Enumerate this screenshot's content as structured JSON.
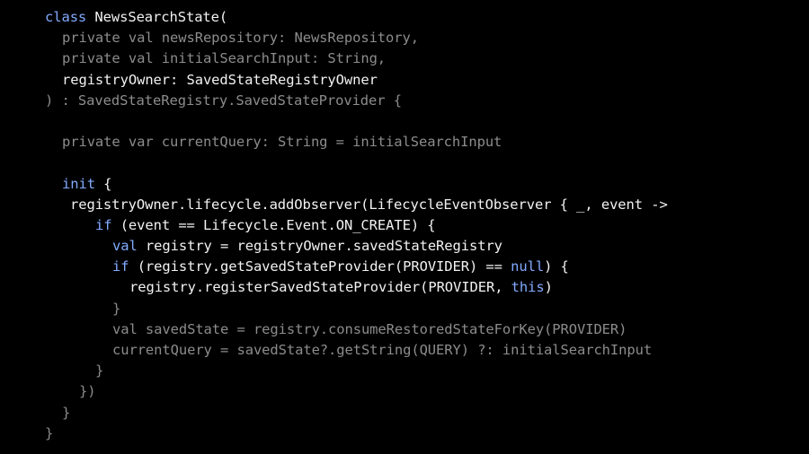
{
  "editor": {
    "colors": {
      "background": "#000000",
      "keyword": "#82aaff",
      "text": "#f2f2f2",
      "dimmed": "#8c8c8c"
    },
    "lines": [
      {
        "indent": 50,
        "tokens": [
          {
            "t": "class ",
            "c": "kw"
          },
          {
            "t": "NewsSearchState(",
            "c": "hi"
          }
        ]
      },
      {
        "indent": 69,
        "tokens": [
          {
            "t": "private val newsRepository: NewsRepository,",
            "c": "dim"
          }
        ]
      },
      {
        "indent": 69,
        "tokens": [
          {
            "t": "private val initialSearchInput: String,",
            "c": "dim"
          }
        ]
      },
      {
        "indent": 69,
        "tokens": [
          {
            "t": "registryOwner: SavedStateRegistryOwner",
            "c": "hi"
          }
        ]
      },
      {
        "indent": 50,
        "tokens": [
          {
            "t": ") : SavedStateRegistry.SavedStateProvider {",
            "c": "dim"
          }
        ]
      },
      {
        "indent": 50,
        "tokens": []
      },
      {
        "indent": 69,
        "tokens": [
          {
            "t": "private var currentQuery: String = initialSearchInput",
            "c": "dim"
          }
        ]
      },
      {
        "indent": 50,
        "tokens": []
      },
      {
        "indent": 69,
        "tokens": [
          {
            "t": "init",
            "c": "kw"
          },
          {
            "t": " {",
            "c": "hi"
          }
        ]
      },
      {
        "indent": 78,
        "tokens": [
          {
            "t": "registryOwner.lifecycle.addObserver(LifecycleEventObserver { _, event ->",
            "c": "hi"
          }
        ]
      },
      {
        "indent": 106,
        "tokens": [
          {
            "t": "if",
            "c": "kw"
          },
          {
            "t": " (event == Lifecycle.Event.ON_CREATE) {",
            "c": "hi"
          }
        ]
      },
      {
        "indent": 125,
        "tokens": [
          {
            "t": "val",
            "c": "kw"
          },
          {
            "t": " registry = registryOwner.savedStateRegistry",
            "c": "hi"
          }
        ]
      },
      {
        "indent": 125,
        "tokens": [
          {
            "t": "if",
            "c": "kw"
          },
          {
            "t": " (registry.getSavedStateProvider(PROVIDER) == ",
            "c": "hi"
          },
          {
            "t": "null",
            "c": "kw"
          },
          {
            "t": ") {",
            "c": "hi"
          }
        ]
      },
      {
        "indent": 144,
        "tokens": [
          {
            "t": "registry.registerSavedStateProvider(PROVIDER, ",
            "c": "hi"
          },
          {
            "t": "this",
            "c": "kw"
          },
          {
            "t": ")",
            "c": "hi"
          }
        ]
      },
      {
        "indent": 125,
        "tokens": [
          {
            "t": "}",
            "c": "dim"
          }
        ]
      },
      {
        "indent": 125,
        "tokens": [
          {
            "t": "val savedState = registry.consumeRestoredStateForKey(PROVIDER)",
            "c": "dim"
          }
        ]
      },
      {
        "indent": 125,
        "tokens": [
          {
            "t": "currentQuery = savedState?.getString(QUERY) ?: initialSearchInput",
            "c": "dim"
          }
        ]
      },
      {
        "indent": 106,
        "tokens": [
          {
            "t": "}",
            "c": "dim"
          }
        ]
      },
      {
        "indent": 88,
        "tokens": [
          {
            "t": "})",
            "c": "dim"
          }
        ]
      },
      {
        "indent": 69,
        "tokens": [
          {
            "t": "}",
            "c": "dim"
          }
        ]
      },
      {
        "indent": 50,
        "tokens": [
          {
            "t": "}",
            "c": "dim"
          }
        ]
      }
    ]
  }
}
